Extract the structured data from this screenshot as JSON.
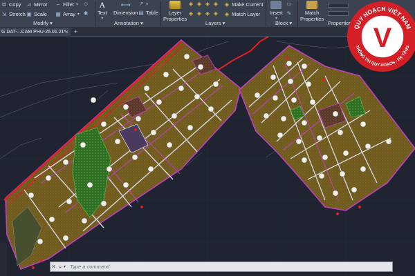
{
  "ribbon": {
    "modify": {
      "copy": "Copy",
      "mirror": "Mirror",
      "fillet": "Fillet",
      "stretch": "Stretch",
      "scale": "Scale",
      "array": "Array",
      "panel_label": "Modify"
    },
    "annotation": {
      "text": "Text",
      "dimension": "Dimension",
      "table": "Table",
      "panel_label": "Annotation"
    },
    "layers": {
      "layer_properties_line1": "Layer",
      "layer_properties_line2": "Properties",
      "make_current": "Make Current",
      "match_layer": "Match Layer",
      "panel_label": "Layers"
    },
    "block": {
      "insert": "Insert",
      "panel_label": "Block"
    },
    "properties": {
      "match_properties_line1": "Match",
      "match_properties_line2": "Properties",
      "panel_label": "Properties"
    }
  },
  "file_tab": {
    "name": "G DAT-...CAM PHU-26.01.21*"
  },
  "command_line": {
    "placeholder": "Type a command"
  },
  "watermark": {
    "line_top": "QUY HOẠCH VIỆT NAM",
    "line_bottom": "THÔNG TIN QUY HOẠCH - HẠ TẦNG",
    "letter": "V"
  },
  "colors": {
    "ribbon_bg": "#3b4250",
    "canvas_bg": "#1f2430",
    "block_fill": "#7a6320",
    "road_red": "#e0202a",
    "road_magenta": "#c040c0",
    "green_space": "#3d8c2c",
    "badge_red": "#d41f26"
  }
}
